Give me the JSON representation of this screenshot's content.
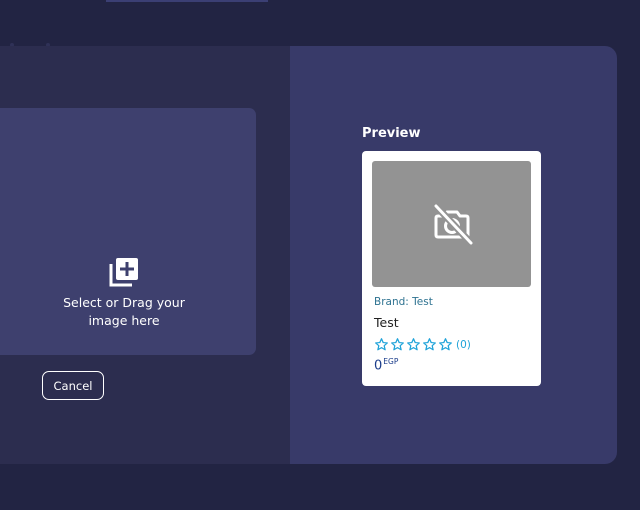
{
  "upload": {
    "prompt_line1": "Select or Drag your",
    "prompt_line2": "image here",
    "cancel_label": "Cancel"
  },
  "preview": {
    "label": "Preview",
    "card": {
      "brand": "Brand: Test",
      "name": "Test",
      "rating": 0,
      "rating_max": 5,
      "rating_count": "(0)",
      "price": "0",
      "currency": "EGP"
    }
  },
  "icons": {
    "upload": "add-photo-icon",
    "no_image": "no-camera-icon",
    "star": "star-outline-icon"
  },
  "colors": {
    "background": "#222443",
    "modal_left": "#2c2d4f",
    "modal_right": "#383a69",
    "dropzone": "#3e406e",
    "star": "#1fa3d9",
    "brand_text": "#2f7391",
    "price_text": "#1a3c8a"
  }
}
